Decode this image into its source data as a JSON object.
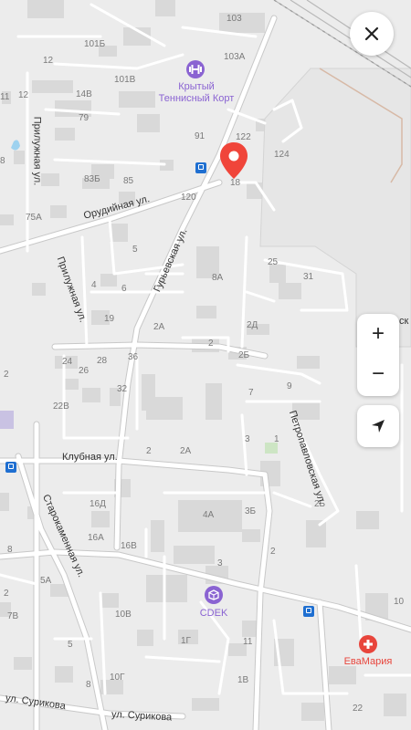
{
  "colors": {
    "background": "#ececec",
    "building": "#d9d9d9",
    "road": "#ffffff",
    "road_edge": "#bdbdbd",
    "railway": "#b5b5b5",
    "marker": "#f0453a",
    "poi_purple": "#8a63d2",
    "poi_red": "#e8453c",
    "bus_stop": "#1f6fd1",
    "water": "#9ed2ef"
  },
  "poi": {
    "tennis": {
      "name": "Крытый Теннисный Корт",
      "line1": "Крытый",
      "line2": "Теннисный Корт",
      "icon": "dumbbell-icon"
    },
    "cdek": {
      "name": "CDEK",
      "icon": "box-icon"
    },
    "pharmacy": {
      "name": "ЕваМария",
      "icon": "medical-cross-icon"
    }
  },
  "streets": {
    "orudiynaya": "Орудийная ул.",
    "prilujnaya1": "Прилужная ул.",
    "prilujnaya2": "Прилужная ул.",
    "guryevskaya": "Гурьевская ул.",
    "klubnaya": "Клубная ул.",
    "starokamennaya": "Старокаменная ул.",
    "petropavlovskaya": "Петропавловская ул.",
    "surikova1": "ул. Сурикова",
    "surikova2": "ул. Сурикова",
    "cut_label": "ск"
  },
  "house_numbers": [
    "103",
    "101Б",
    "103А",
    "12",
    "101В",
    "14В",
    "12",
    "11",
    "79",
    "91",
    "122",
    "124",
    "8",
    "83Б",
    "85",
    "18",
    "120",
    "75А",
    "5",
    "25",
    "31",
    "4",
    "6",
    "8А",
    "19",
    "2А",
    "2Д",
    "2",
    "2Б",
    "24",
    "26",
    "28",
    "36",
    "9",
    "32",
    "7",
    "22В",
    "2",
    "2А",
    "3",
    "1",
    "2",
    "16Д",
    "3Б",
    "4А",
    "2Б",
    "16А",
    "16В",
    "8",
    "5А",
    "2",
    "3",
    "2",
    "7В",
    "10В",
    "1Г",
    "5",
    "11",
    "10Г",
    "1В",
    "8",
    "10",
    "22"
  ],
  "controls": {
    "close_icon": "close-icon",
    "zoom_in": "+",
    "zoom_out": "−",
    "locate_icon": "navigation-arrow-icon"
  }
}
